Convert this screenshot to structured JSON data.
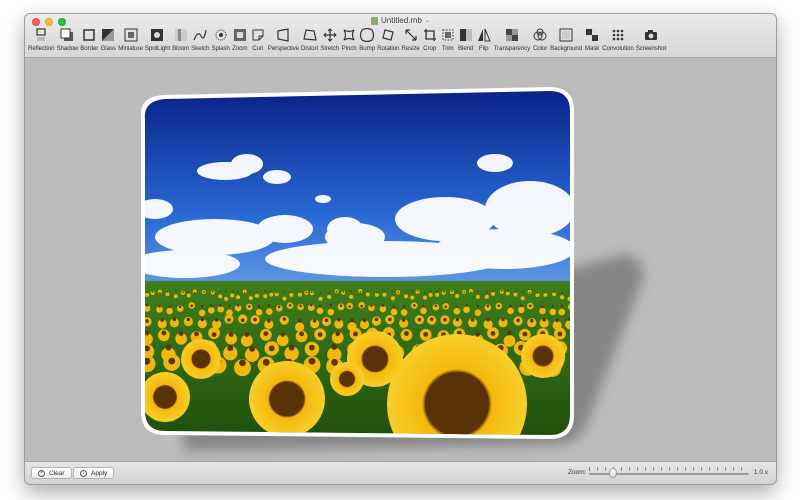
{
  "window": {
    "title": "Untitled.rnb"
  },
  "toolbar": {
    "tools": [
      {
        "label": "Reflection",
        "icon": "reflection-icon"
      },
      {
        "label": "Shadow",
        "icon": "shadow-icon"
      },
      {
        "label": "Border",
        "icon": "border-icon"
      },
      {
        "label": "Glass",
        "icon": "glass-icon"
      },
      {
        "label": "Miniature",
        "icon": "miniature-icon"
      },
      {
        "label": "SpotLight",
        "icon": "spotlight-icon"
      },
      {
        "label": "Bloom",
        "icon": "bloom-icon"
      },
      {
        "label": "Sketch",
        "icon": "sketch-icon"
      },
      {
        "label": "Splash",
        "icon": "splash-icon"
      },
      {
        "label": "Zoom",
        "icon": "zoom-icon"
      },
      {
        "label": "Curl",
        "icon": "curl-icon"
      },
      {
        "label": "Perspective",
        "icon": "perspective-icon"
      },
      {
        "label": "Distort",
        "icon": "distort-icon"
      },
      {
        "label": "Stretch",
        "icon": "stretch-icon"
      },
      {
        "label": "Pinch",
        "icon": "pinch-icon"
      },
      {
        "label": "Bump",
        "icon": "bump-icon"
      },
      {
        "label": "Rotation",
        "icon": "rotation-icon"
      },
      {
        "label": "Resize",
        "icon": "resize-icon"
      },
      {
        "label": "Crop",
        "icon": "crop-icon"
      },
      {
        "label": "Trim",
        "icon": "trim-icon"
      },
      {
        "label": "Blend",
        "icon": "blend-icon"
      },
      {
        "label": "Flip",
        "icon": "flip-icon"
      },
      {
        "label": "Transparency",
        "icon": "transparency-icon"
      },
      {
        "label": "Color",
        "icon": "color-icon"
      },
      {
        "label": "Background",
        "icon": "background-icon"
      },
      {
        "label": "Mask",
        "icon": "mask-icon"
      },
      {
        "label": "Convolution",
        "icon": "convolution-icon"
      },
      {
        "label": "Screenshot",
        "icon": "camera-icon"
      }
    ]
  },
  "statusbar": {
    "clear_label": "Clear",
    "apply_label": "Apply",
    "zoom_label": "Zoom:",
    "zoom_value": "1.0 x",
    "zoom_fraction": 0.15
  },
  "colors": {
    "sky_top": "#0b2aa0",
    "sky_bottom": "#3b7ee0",
    "grass": "#3f8a1c",
    "petal": "#f5c211"
  }
}
